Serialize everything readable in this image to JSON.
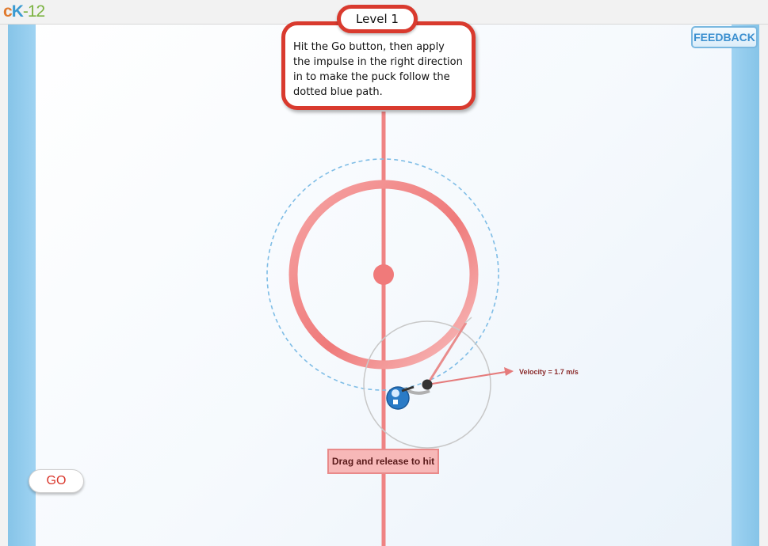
{
  "header": {
    "logo_c": "c",
    "logo_k": "K",
    "logo_n": "-12"
  },
  "level": {
    "title": "Level 1"
  },
  "instructions": {
    "text": "Hit the Go button, then apply the impulse in the right direction in to make the puck follow the dotted blue path."
  },
  "buttons": {
    "feedback": "FEEDBACK",
    "go": "GO"
  },
  "hint": {
    "drag": "Drag and release to hit"
  },
  "readout": {
    "velocity": "Velocity = 1.7 m/s"
  },
  "colors": {
    "rink_line": "#ef7f7f",
    "border_red": "#d93a2e",
    "path_blue": "#7fbde6",
    "wall_blue": "#8fcbee"
  }
}
